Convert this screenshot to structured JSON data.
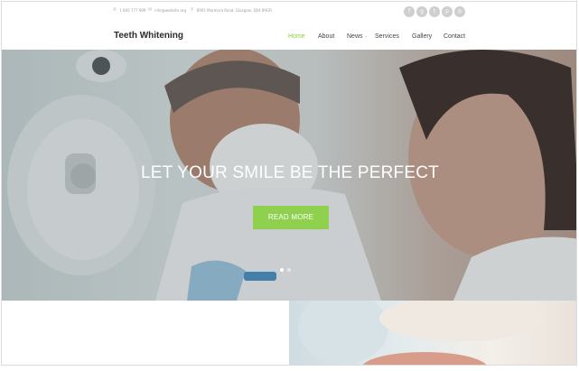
{
  "topbar": {
    "phone": "1 800 777 909",
    "email": "info@website.org",
    "address": "8901 Marmora Road, Glasgow, D04 89GR",
    "phone_icon": "phone-icon",
    "email_icon": "envelope-icon",
    "address_icon": "map-pin-icon",
    "socials": [
      {
        "icon": "facebook-icon",
        "glyph": "f"
      },
      {
        "icon": "google-plus-icon",
        "glyph": "g"
      },
      {
        "icon": "twitter-icon",
        "glyph": "t"
      },
      {
        "icon": "pinterest-icon",
        "glyph": "p"
      },
      {
        "icon": "instagram-icon",
        "glyph": "◎"
      }
    ]
  },
  "header": {
    "brand": "Teeth Whitening",
    "nav": [
      {
        "label": "Home",
        "active": true
      },
      {
        "label": "About",
        "active": false
      },
      {
        "label": "News",
        "active": false,
        "has_dropdown": true
      },
      {
        "label": "Services",
        "active": false
      },
      {
        "label": "Gallery",
        "active": false
      },
      {
        "label": "Contact",
        "active": false
      }
    ]
  },
  "hero": {
    "title": "LET YOUR SMILE BE THE PERFECT",
    "button_label": "READ MORE",
    "slide_count": 2,
    "active_slide": 1
  },
  "colors": {
    "accent": "#8fd14f",
    "nav_active": "#8ccb3b",
    "text_dark": "#2b2b2b",
    "social_bg": "#cfcfcf"
  }
}
